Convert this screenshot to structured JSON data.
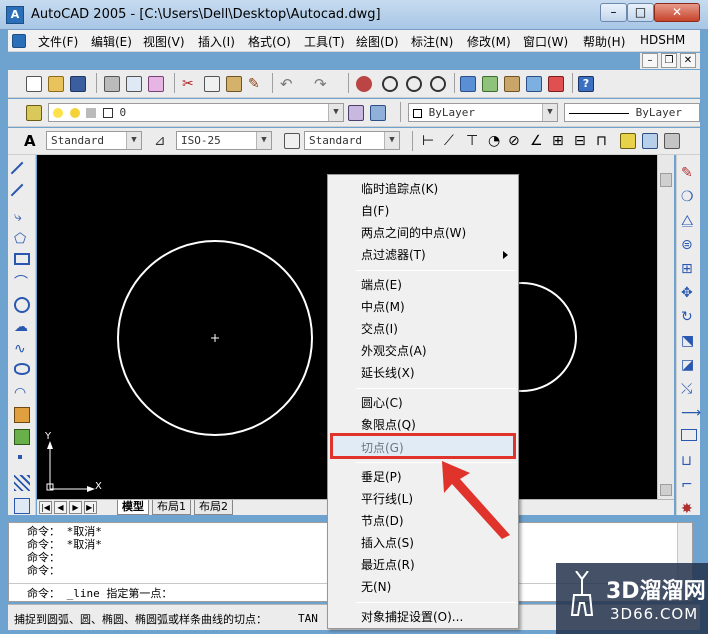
{
  "window": {
    "title": "AutoCAD 2005 - [C:\\Users\\Dell\\Desktop\\Autocad.dwg]",
    "app_icon_glyph": "A",
    "min_glyph": "–",
    "max_glyph": "□",
    "close_glyph": "✕"
  },
  "menubar": {
    "items": [
      "文件(F)",
      "编辑(E)",
      "视图(V)",
      "插入(I)",
      "格式(O)",
      "工具(T)",
      "绘图(D)",
      "标注(N)",
      "修改(M)",
      "窗口(W)",
      "帮助(H)",
      "HDSHM"
    ],
    "mdi_min": "–",
    "mdi_restore": "❐",
    "mdi_close": "✕"
  },
  "toolbar_layers": {
    "layer_value": "0",
    "color_value": "ByLayer",
    "linetype_value": "ByLayer"
  },
  "toolbar_styles": {
    "text_style": "Standard",
    "dim_style": "ISO-25",
    "table_style": "Standard"
  },
  "canvas": {
    "background": "#000000",
    "ucs_y": "Y",
    "ucs_x": "X"
  },
  "layout_tabs": [
    "模型",
    "布局1",
    "布局2"
  ],
  "command": {
    "history": [
      "命令： *取消*",
      "命令： *取消*",
      "命令：",
      "命令："
    ],
    "current": "命令： _line 指定第一点："
  },
  "statusbar": {
    "text": "捕捉到圆弧、圆、椭圆、椭圆弧或样条曲线的切点：",
    "extra": "TAN"
  },
  "context_menu": {
    "group1": [
      "临时追踪点(K)",
      "自(F)",
      "两点之间的中点(W)",
      "点过滤器(T)"
    ],
    "group2": [
      "端点(E)",
      "中点(M)",
      "交点(I)",
      "外观交点(A)",
      "延长线(X)"
    ],
    "group3": [
      "圆心(C)",
      "象限点(Q)",
      "切点(G)"
    ],
    "group4": [
      "垂足(P)",
      "平行线(L)",
      "节点(D)",
      "插入点(S)",
      "最近点(R)",
      "无(N)"
    ],
    "group5": [
      "对象捕捉设置(O)..."
    ],
    "highlight_color": "#e0332b"
  },
  "watermark": {
    "brand": "3D溜溜网",
    "site": "3D66.COM"
  }
}
